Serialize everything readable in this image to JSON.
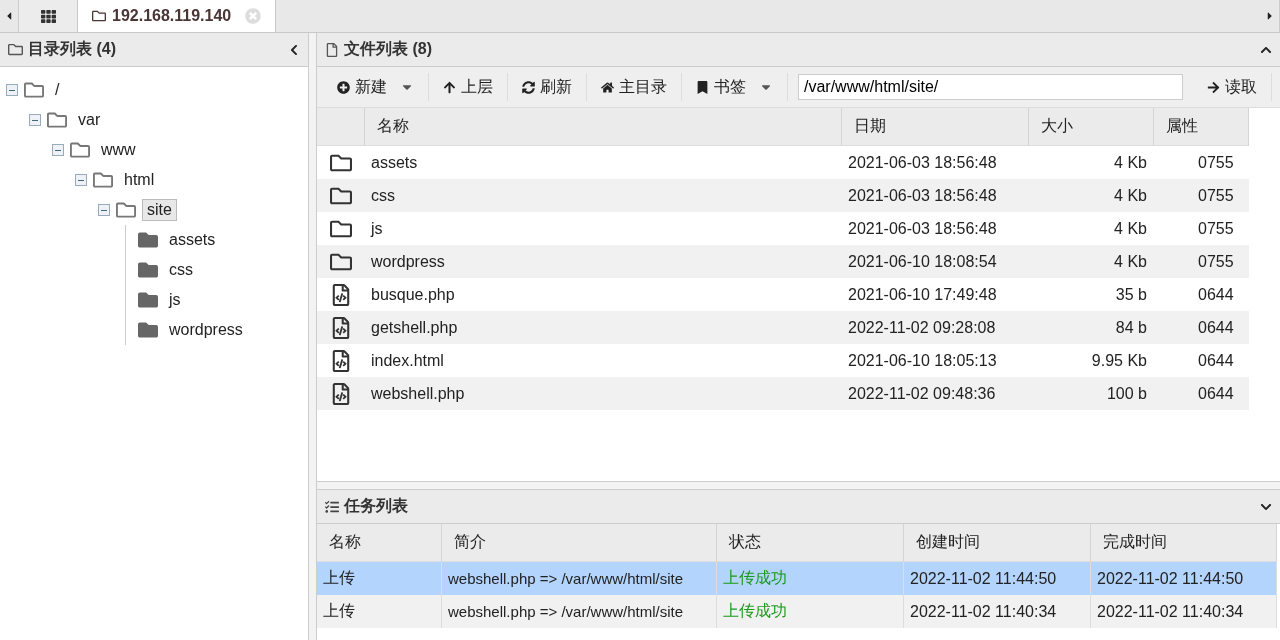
{
  "tabs": [
    {
      "kind": "home",
      "selected": false
    },
    {
      "kind": "host",
      "label": "192.168.119.140",
      "selected": true
    }
  ],
  "directory_panel": {
    "title": "目录列表 (4)",
    "tree": [
      {
        "name": "/",
        "selected": false,
        "children": [
          {
            "name": "var",
            "selected": false,
            "children": [
              {
                "name": "www",
                "selected": false,
                "children": [
                  {
                    "name": "html",
                    "selected": false,
                    "children": [
                      {
                        "name": "site",
                        "selected": true,
                        "children": [
                          {
                            "name": "assets",
                            "selected": false
                          },
                          {
                            "name": "css",
                            "selected": false
                          },
                          {
                            "name": "js",
                            "selected": false
                          },
                          {
                            "name": "wordpress",
                            "selected": false
                          }
                        ]
                      }
                    ]
                  }
                ]
              }
            ]
          }
        ]
      }
    ]
  },
  "file_panel": {
    "title": "文件列表 (8)",
    "toolbar": [
      {
        "kind": "new",
        "label": "新建",
        "dropdown": true
      },
      {
        "kind": "up",
        "label": "上层",
        "dropdown": false
      },
      {
        "kind": "refresh",
        "label": "刷新",
        "dropdown": false
      },
      {
        "kind": "home",
        "label": "主目录",
        "dropdown": false
      },
      {
        "kind": "bookmark",
        "label": "书签",
        "dropdown": true
      }
    ],
    "path": "/var/www/html/site/",
    "read_button": "读取",
    "columns": [
      "名称",
      "日期",
      "大小",
      "属性"
    ],
    "rows": [
      {
        "kind": "folder",
        "name": "assets",
        "date": "2021-06-03 18:56:48",
        "size": "4 Kb",
        "mode": "0755"
      },
      {
        "kind": "folder",
        "name": "css",
        "date": "2021-06-03 18:56:48",
        "size": "4 Kb",
        "mode": "0755"
      },
      {
        "kind": "folder",
        "name": "js",
        "date": "2021-06-03 18:56:48",
        "size": "4 Kb",
        "mode": "0755"
      },
      {
        "kind": "folder",
        "name": "wordpress",
        "date": "2021-06-10 18:08:54",
        "size": "4 Kb",
        "mode": "0755"
      },
      {
        "kind": "code",
        "name": "busque.php",
        "date": "2021-06-10 17:49:48",
        "size": "35 b",
        "mode": "0644"
      },
      {
        "kind": "code",
        "name": "getshell.php",
        "date": "2022-11-02 09:28:08",
        "size": "84 b",
        "mode": "0644"
      },
      {
        "kind": "code",
        "name": "index.html",
        "date": "2021-06-10 18:05:13",
        "size": "9.95 Kb",
        "mode": "0644"
      },
      {
        "kind": "code",
        "name": "webshell.php",
        "date": "2022-11-02 09:48:36",
        "size": "100 b",
        "mode": "0644"
      }
    ]
  },
  "task_panel": {
    "title": "任务列表",
    "columns": [
      "名称",
      "简介",
      "状态",
      "创建时间",
      "完成时间"
    ],
    "rows": [
      {
        "name": "上传",
        "summary": "webshell.php => /var/www/html/site",
        "status": "上传成功",
        "created": "2022-11-02 11:44:50",
        "finished": "2022-11-02 11:44:50",
        "selected": true
      },
      {
        "name": "上传",
        "summary": "webshell.php => /var/www/html/site",
        "status": "上传成功",
        "created": "2022-11-02 11:40:34",
        "finished": "2022-11-02 11:40:34",
        "selected": false
      }
    ]
  }
}
